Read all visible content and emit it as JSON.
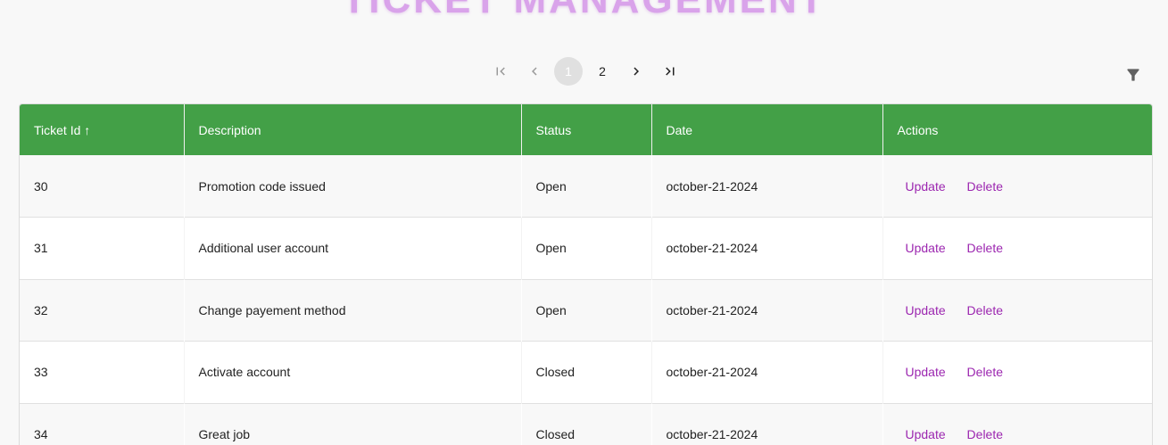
{
  "page": {
    "title": "TICKET MANAGEMENT"
  },
  "pagination": {
    "pages": [
      "1",
      "2"
    ],
    "current_page": 1
  },
  "colors": {
    "header_bg": "#43a047",
    "action_text": "#9c27b0",
    "title": "#d9a3ea"
  },
  "icons": {
    "first": "first-page-icon",
    "prev": "chevron-left-icon",
    "next": "chevron-right-icon",
    "last": "last-page-icon",
    "filter": "filter-icon"
  },
  "table": {
    "columns": [
      {
        "label": "Ticket Id ↑"
      },
      {
        "label": "Description"
      },
      {
        "label": "Status"
      },
      {
        "label": "Date"
      },
      {
        "label": "Actions"
      }
    ],
    "rows": [
      {
        "id": "30",
        "description": "Promotion code issued",
        "status": "Open",
        "date": "october-21-2024"
      },
      {
        "id": "31",
        "description": "Additional user account",
        "status": "Open",
        "date": "october-21-2024"
      },
      {
        "id": "32",
        "description": "Change payement method",
        "status": "Open",
        "date": "october-21-2024"
      },
      {
        "id": "33",
        "description": "Activate account",
        "status": "Closed",
        "date": "october-21-2024"
      },
      {
        "id": "34",
        "description": "Great job",
        "status": "Closed",
        "date": "october-21-2024"
      }
    ],
    "update_label": "Update",
    "delete_label": "Delete"
  }
}
